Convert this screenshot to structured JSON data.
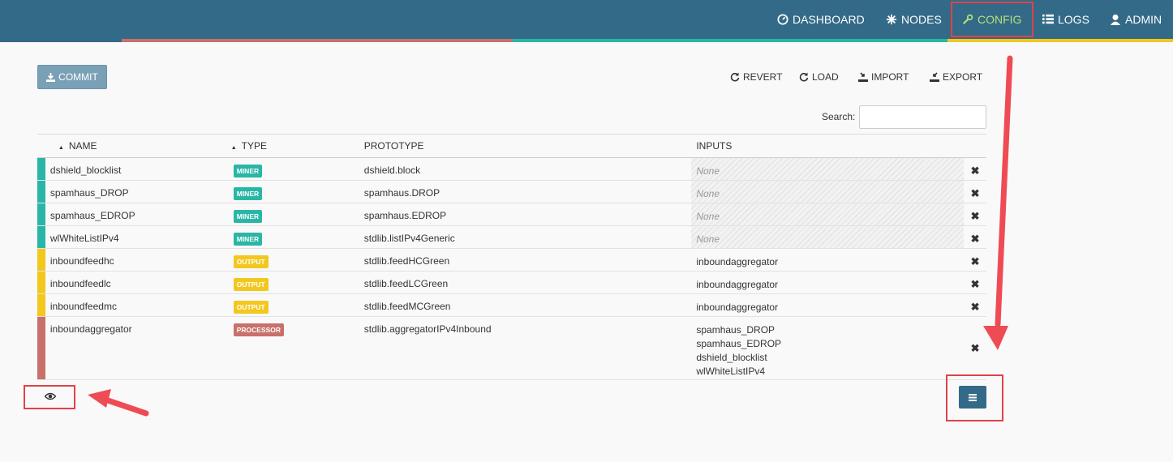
{
  "nav": {
    "dashboard": "DASHBOARD",
    "nodes": "NODES",
    "config": "CONFIG",
    "logs": "LOGS",
    "admin": "ADMIN"
  },
  "toolbar": {
    "commit": "COMMIT",
    "revert": "REVERT",
    "load": "LOAD",
    "import": "IMPORT",
    "export": "EXPORT"
  },
  "search": {
    "label": "Search:",
    "value": ""
  },
  "table": {
    "headers": {
      "name": "NAME",
      "type": "TYPE",
      "prototype": "PROTOTYPE",
      "inputs": "INPUTS"
    },
    "rows": [
      {
        "name": "dshield_blocklist",
        "type": "MINER",
        "prototype": "dshield.block",
        "inputs": [
          "None"
        ],
        "color": "#2ab6a6"
      },
      {
        "name": "spamhaus_DROP",
        "type": "MINER",
        "prototype": "spamhaus.DROP",
        "inputs": [
          "None"
        ],
        "color": "#2ab6a6"
      },
      {
        "name": "spamhaus_EDROP",
        "type": "MINER",
        "prototype": "spamhaus.EDROP",
        "inputs": [
          "None"
        ],
        "color": "#2ab6a6"
      },
      {
        "name": "wlWhiteListIPv4",
        "type": "MINER",
        "prototype": "stdlib.listIPv4Generic",
        "inputs": [
          "None"
        ],
        "color": "#2ab6a6"
      },
      {
        "name": "inboundfeedhc",
        "type": "OUTPUT",
        "prototype": "stdlib.feedHCGreen",
        "inputs": [
          "inboundaggregator"
        ],
        "color": "#f2c81f"
      },
      {
        "name": "inboundfeedlc",
        "type": "OUTPUT",
        "prototype": "stdlib.feedLCGreen",
        "inputs": [
          "inboundaggregator"
        ],
        "color": "#f2c81f"
      },
      {
        "name": "inboundfeedmc",
        "type": "OUTPUT",
        "prototype": "stdlib.feedMCGreen",
        "inputs": [
          "inboundaggregator"
        ],
        "color": "#f2c81f"
      },
      {
        "name": "inboundaggregator",
        "type": "PROCESSOR",
        "prototype": "stdlib.aggregatorIPv4Inbound",
        "inputs": [
          "spamhaus_DROP",
          "spamhaus_EDROP",
          "dshield_blocklist",
          "wlWhiteListIPv4"
        ],
        "color": "#c8706a"
      }
    ],
    "delete_glyph": "✖"
  },
  "icons": {
    "dashboard": "dashboard-icon",
    "nodes": "nodes-icon",
    "config": "wrench-icon",
    "logs": "list-icon",
    "admin": "user-icon",
    "commit": "download-icon",
    "revert": "refresh-icon",
    "load": "refresh-icon",
    "import": "import-icon",
    "export": "export-icon",
    "eye": "eye-icon",
    "menu": "menu-icon"
  },
  "colors": {
    "navbar": "#336a87",
    "active_nav": "#b7e07a",
    "miner": "#2ab6a6",
    "output": "#f2c81f",
    "processor": "#c8706a",
    "highlight": "#e0424a"
  }
}
